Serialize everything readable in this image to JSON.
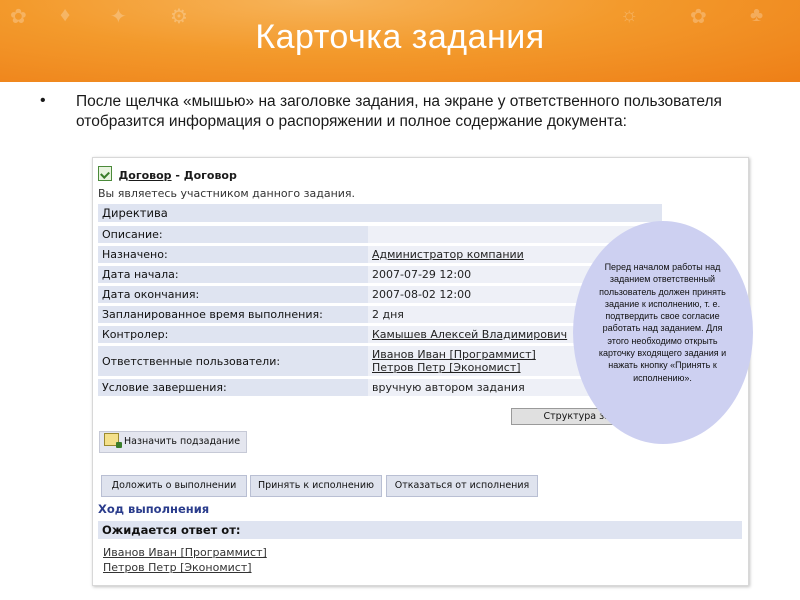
{
  "slide": {
    "title": "Карточка задания",
    "bullet": "•",
    "intro": "После щелчка «мышью» на заголовке задания, на экране у ответственного пользователя отобразится информация о распоряжении и полное содержание документа:"
  },
  "card": {
    "title_part1": "Договор",
    "title_sep": " - ",
    "title_part2": "Договор",
    "participant_text": "Вы являетесь участником данного задания.",
    "directive_label": "Директива",
    "rows": [
      {
        "label": "Описание:",
        "value": ""
      },
      {
        "label": "Назначено:",
        "value": "Администратор компании"
      },
      {
        "label": "Дата начала:",
        "value": "2007-07-29 12:00"
      },
      {
        "label": "Дата окончания:",
        "value": "2007-08-02 12:00"
      },
      {
        "label": "Запланированное время выполнения:",
        "value": "2 дня"
      },
      {
        "label": "Контролер:",
        "value": "Камышев Алексей Владимирович"
      },
      {
        "label": "Ответственные пользователи:",
        "value": "Иванов Иван [Программист]",
        "value2": "Петров Петр [Экономист]"
      },
      {
        "label": "Условие завершения:",
        "value": "вручную автором задания"
      }
    ],
    "structure_button": "Структура задания",
    "assign_subtask_button": "Назначить подзадание",
    "actions": {
      "report": "Доложить о выполнении",
      "accept": "Принять к исполнению",
      "refuse": "Отказаться от исполнения"
    },
    "progress_title": "Ход выполнения",
    "waiting_label": "Ожидается ответ от:",
    "responders": [
      "Иванов Иван [Программист]",
      "Петров Петр [Экономист]"
    ]
  },
  "callout": {
    "text": "Перед началом работы над заданием ответственный пользователь должен принять задание к исполнению, т. е. подтвердить свое согласие работать над заданием. Для этого необходимо открыть карточку входящего задания и нажать кнопку «Принять к исполнению»."
  },
  "colors": {
    "header_orange": "#f39a2c",
    "label_bg": "#dfe4f1",
    "callout_bg": "#cdd0f1",
    "link_blue": "#2a3c8c"
  }
}
